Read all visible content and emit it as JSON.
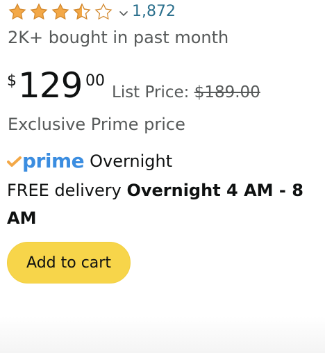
{
  "rating": {
    "stars": 3.5,
    "review_count": "1,872",
    "star_color": "#f3a847"
  },
  "purchase_info": "2K+ bought in past month",
  "price": {
    "symbol": "$",
    "whole": "129",
    "fraction": "00",
    "list_label": "List Price:",
    "list_value": "$189.00"
  },
  "prime_note": "Exclusive Prime price",
  "shipping": {
    "prime_word": "prime",
    "prime_label": "Overnight",
    "delivery_prefix": "FREE delivery",
    "delivery_window": "Overnight 4 AM - 8 AM"
  },
  "cart_button": {
    "label": "Add to cart",
    "color": "#f7d54a"
  },
  "colors": {
    "link": "#2a6f8c",
    "prime_blue": "#3b8de0",
    "prime_check": "#f3a847",
    "muted_text": "#565959"
  },
  "icons": [
    "star-icon",
    "chevron-down-icon",
    "prime-check-icon"
  ]
}
